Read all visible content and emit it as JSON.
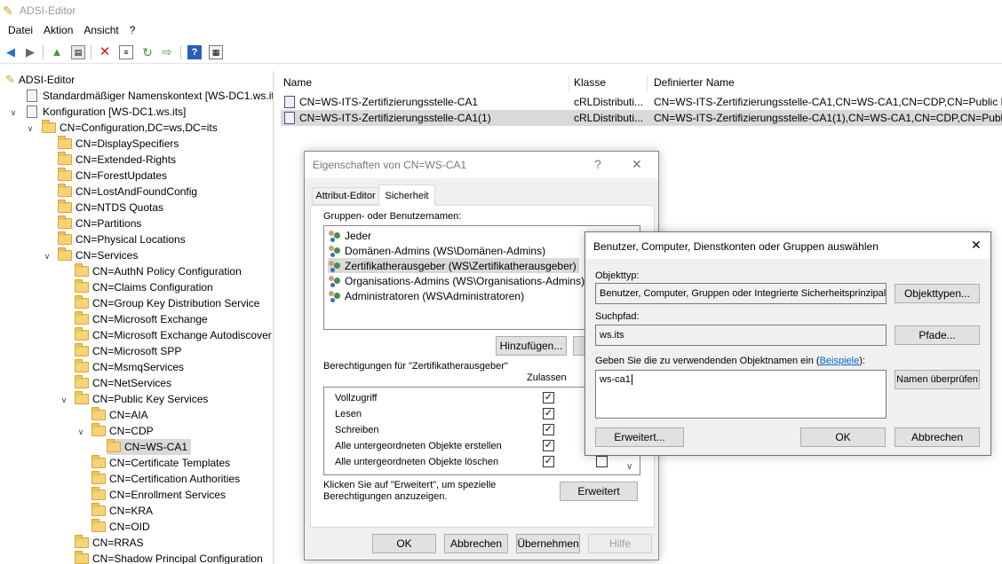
{
  "app": {
    "title": "ADSI-Editor"
  },
  "menu": [
    "Datei",
    "Aktion",
    "Ansicht",
    "?"
  ],
  "toolbar_icons": [
    "back-arrow-icon",
    "forward-arrow-icon",
    "up-folder-icon",
    "show-hide-tree-icon",
    "delete-icon",
    "properties-icon",
    "refresh-icon",
    "export-icon",
    "help-icon",
    "view-icon"
  ],
  "tree": {
    "root": "ADSI-Editor",
    "items": [
      "Standardmäßiger Namenskontext [WS-DC1.ws.its",
      "Konfiguration [WS-DC1.ws.its]",
      "CN=Configuration,DC=ws,DC=its",
      "CN=DisplaySpecifiers",
      "CN=Extended-Rights",
      "CN=ForestUpdates",
      "CN=LostAndFoundConfig",
      "CN=NTDS Quotas",
      "CN=Partitions",
      "CN=Physical Locations",
      "CN=Services",
      "CN=AuthN Policy Configuration",
      "CN=Claims Configuration",
      "CN=Group Key Distribution Service",
      "CN=Microsoft Exchange",
      "CN=Microsoft Exchange Autodiscover",
      "CN=Microsoft SPP",
      "CN=MsmqServices",
      "CN=NetServices",
      "CN=Public Key Services",
      "CN=AIA",
      "CN=CDP",
      "CN=WS-CA1",
      "CN=Certificate Templates",
      "CN=Certification Authorities",
      "CN=Enrollment Services",
      "CN=KRA",
      "CN=OID",
      "CN=RRAS",
      "CN=Shadow Principal Configuration"
    ]
  },
  "list": {
    "columns": [
      "Name",
      "Klasse",
      "Definierter Name"
    ],
    "rows": [
      {
        "name": "CN=WS-ITS-Zertifizierungsstelle-CA1",
        "klasse": "cRLDistributi...",
        "dn": "CN=WS-ITS-Zertifizierungsstelle-CA1,CN=WS-CA1,CN=CDP,CN=Public K"
      },
      {
        "name": "CN=WS-ITS-Zertifizierungsstelle-CA1(1)",
        "klasse": "cRLDistributi...",
        "dn": "CN=WS-ITS-Zertifizierungsstelle-CA1(1),CN=WS-CA1,CN=CDP,CN=Public"
      }
    ]
  },
  "props": {
    "title": "Eigenschaften von CN=WS-CA1",
    "help": "?",
    "close": "✕",
    "tabs": [
      "Attribut-Editor",
      "Sicherheit"
    ],
    "groups_label": "Gruppen- oder Benutzernamen:",
    "users": [
      "Jeder",
      "Domänen-Admins (WS\\Domänen-Admins)",
      "Zertifikatherausgeber (WS\\Zertifikatherausgeber)",
      "Organisations-Admins (WS\\Organisations-Admins)",
      "Administratoren (WS\\Administratoren)"
    ],
    "add_button": "Hinzufügen...",
    "perms_label": "Berechtigungen für \"Zertifikatherausgeber\"",
    "allow_col": "Zulassen",
    "perms": [
      "Vollzugriff",
      "Lesen",
      "Schreiben",
      "Alle untergeordneten Objekte erstellen",
      "Alle untergeordneten Objekte löschen"
    ],
    "advanced_hint": "Klicken Sie auf \"Erweitert\", um spezielle Berechtigungen anzuzeigen.",
    "advanced_button": "Erweitert",
    "ok": "OK",
    "cancel": "Abbrechen",
    "apply": "Übernehmen",
    "help_button": "Hilfe"
  },
  "select": {
    "title": "Benutzer, Computer, Dienstkonten oder Gruppen auswählen",
    "close": "✕",
    "objtype_label": "Objekttyp:",
    "objtype_value": "Benutzer, Computer, Gruppen oder Integrierte Sicherheitsprinzipale",
    "objtype_button": "Objekttypen...",
    "path_label": "Suchpfad:",
    "path_value": "ws.its",
    "path_button": "Pfade...",
    "names_label": "Geben Sie die zu verwendenden Objektnamen ein (",
    "names_link": "Beispiele",
    "names_label_end": "):",
    "names_value": "ws-ca1",
    "check_button": "Namen überprüfen",
    "advanced_button": "Erweitert...",
    "ok": "OK",
    "cancel": "Abbrechen"
  }
}
